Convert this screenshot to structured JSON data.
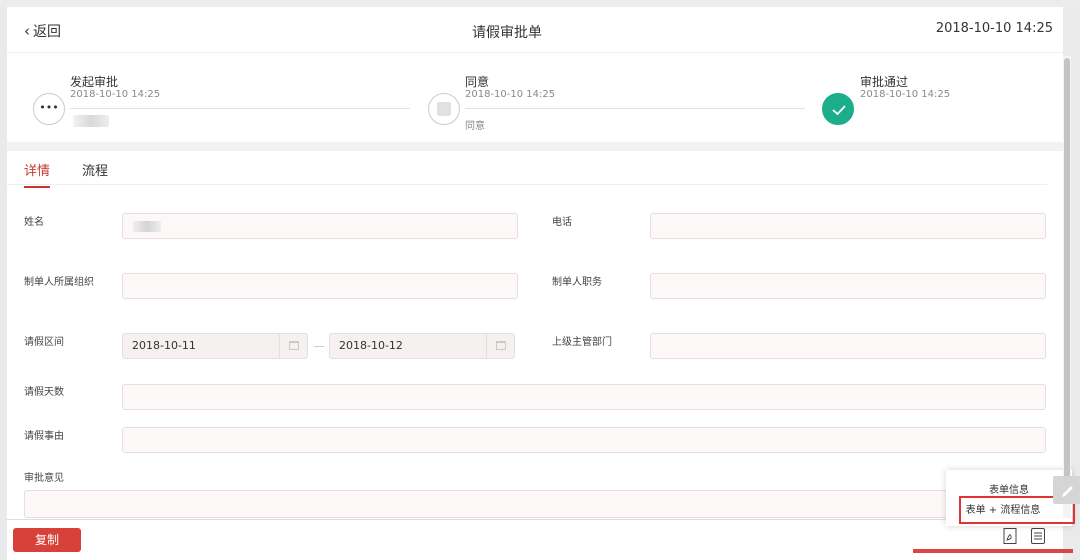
{
  "header": {
    "back_label": "返回",
    "title": "请假审批单",
    "datetime": "2018-10-10 14:25"
  },
  "steps": [
    {
      "title": "发起审批",
      "time": "2018-10-10 14:25",
      "icon": "ellipsis-icon"
    },
    {
      "title": "同意",
      "time": "2018-10-10 14:25",
      "note": "同意",
      "icon": "avatar-placeholder-icon"
    },
    {
      "title": "审批通过",
      "time": "2018-10-10 14:25",
      "icon": "check-icon",
      "status_color": "#1cae8b"
    }
  ],
  "tabs": [
    {
      "label": "详情",
      "active": true
    },
    {
      "label": "流程",
      "active": false
    }
  ],
  "form": {
    "name_label": "姓名",
    "phone_label": "电话",
    "org_label": "制单人所属组织",
    "position_label": "制单人职务",
    "period_label": "请假区间",
    "period_start": "2018-10-11",
    "period_end": "2018-10-12",
    "dept_label": "上级主管部门",
    "days_label": "请假天数",
    "reason_label": "请假事由",
    "opinion_label": "审批意见"
  },
  "footer": {
    "copy_label": "复制",
    "accent_color": "#d8403a"
  },
  "popover": {
    "item1": "表单信息",
    "item2": "表单 + 流程信息",
    "highlight_color": "#e03434"
  }
}
